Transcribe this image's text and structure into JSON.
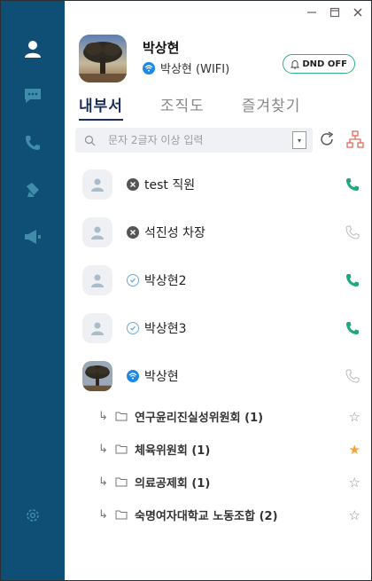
{
  "window": {
    "minimize_icon": "minimize-icon",
    "maximize_icon": "maximize-icon",
    "close_icon": "close-icon"
  },
  "sidebar": {
    "items": [
      {
        "name": "contacts",
        "icon": "person-icon",
        "active": true
      },
      {
        "name": "messages",
        "icon": "chat-icon"
      },
      {
        "name": "calls",
        "icon": "phone-icon"
      },
      {
        "name": "notes",
        "icon": "note-icon"
      },
      {
        "name": "announcements",
        "icon": "megaphone-icon"
      },
      {
        "name": "settings",
        "icon": "gear-icon"
      }
    ]
  },
  "profile": {
    "name": "박상현",
    "status": "박상현  (WIFI)",
    "dnd_label": "DND OFF"
  },
  "tabs": [
    {
      "label": "내부서",
      "active": true
    },
    {
      "label": "조직도",
      "active": false
    },
    {
      "label": "즐겨찾기",
      "active": false
    }
  ],
  "search": {
    "placeholder": "문자 2글자 이상 입력"
  },
  "contacts": [
    {
      "name": "test 직원",
      "status": "offline",
      "phone": "active"
    },
    {
      "name": "석진성 차장",
      "status": "offline",
      "phone": "inactive"
    },
    {
      "name": "박상현2",
      "status": "away",
      "phone": "active"
    },
    {
      "name": "박상현3",
      "status": "away",
      "phone": "active"
    },
    {
      "name": "박상현",
      "status": "online",
      "phone": "inactive",
      "photo": true
    }
  ],
  "groups": [
    {
      "name": "연구윤리진실성위원회 (1)",
      "starred": false
    },
    {
      "name": "체육위원회 (1)",
      "starred": true
    },
    {
      "name": "의료공제회 (1)",
      "starred": false
    },
    {
      "name": "숙명여자대학교 노동조합 (2)",
      "starred": false
    }
  ],
  "colors": {
    "sidebar": "#0f4e75",
    "accent": "#1b2f55",
    "phone_active": "#1fa97a",
    "star": "#f2a33a",
    "dnd_border": "#2db37a"
  }
}
